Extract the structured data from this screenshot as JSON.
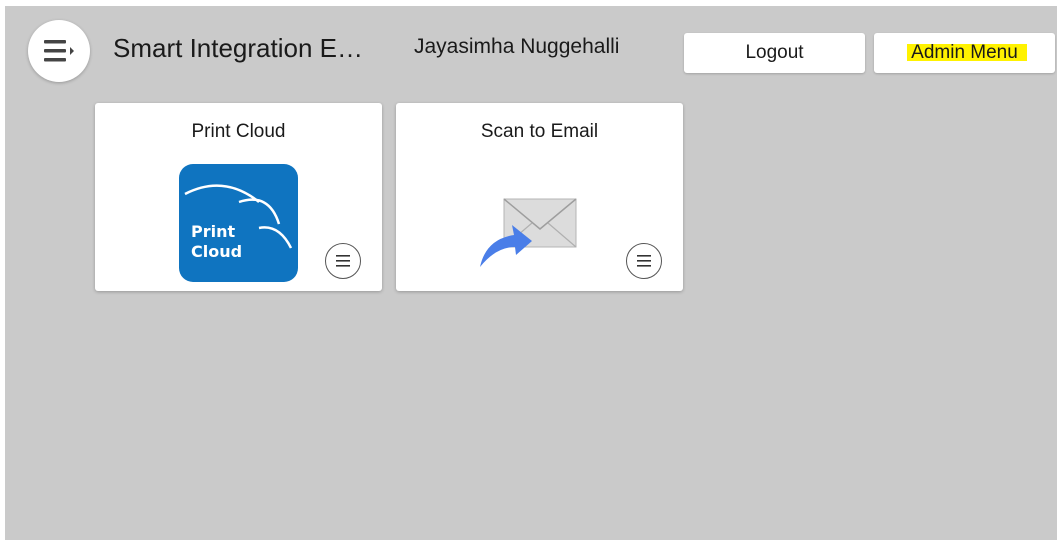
{
  "header": {
    "app_title": "Smart Integration E…",
    "user_name": "Jayasimha Nuggehalli",
    "logout_label": "Logout",
    "admin_menu_label": "Admin Menu"
  },
  "tiles": [
    {
      "title": "Print Cloud",
      "icon_text_line1": "Print",
      "icon_text_line2": "Cloud",
      "icon_color": "#0f74c0"
    },
    {
      "title": "Scan to Email",
      "icon_arrow_color": "#4a7ee8"
    }
  ],
  "colors": {
    "background": "#cacaca",
    "highlight": "#fff200"
  }
}
